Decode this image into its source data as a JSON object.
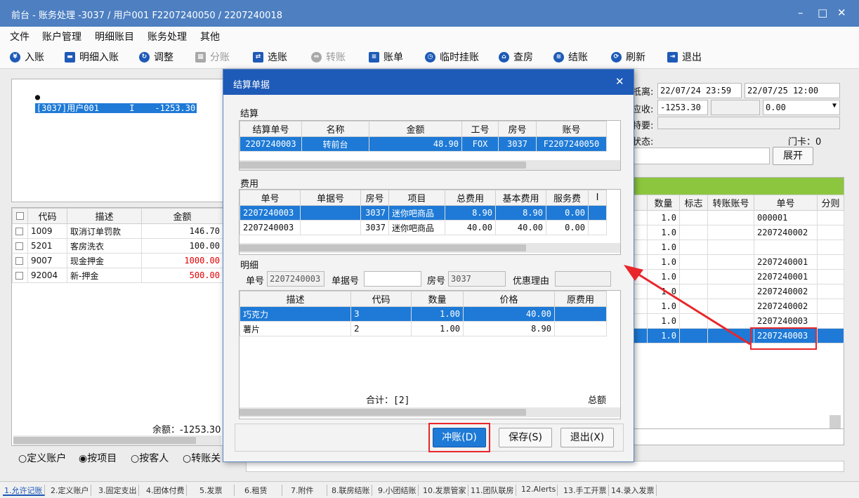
{
  "window": {
    "title": "前台 - 账务处理 -3037 / 用户001 F2207240050 / 2207240018",
    "minimize": "–",
    "maximize": "□",
    "close": "✕"
  },
  "menu": [
    "文件",
    "账户管理",
    "明细账目",
    "账务处理",
    "其他"
  ],
  "toolbar": [
    {
      "label": "入账",
      "icon": "yen-icon",
      "glyph": "¥",
      "disabled": false
    },
    {
      "label": "明细入账",
      "icon": "ledger-icon",
      "glyph": "▬",
      "disabled": false
    },
    {
      "label": "调整",
      "icon": "adjust-icon",
      "glyph": "↻",
      "disabled": false
    },
    {
      "label": "分账",
      "icon": "split-icon",
      "glyph": "▦",
      "disabled": true
    },
    {
      "label": "选账",
      "icon": "select-icon",
      "glyph": "⇄",
      "disabled": false
    },
    {
      "label": "转账",
      "icon": "transfer-icon",
      "glyph": "⇔",
      "disabled": true
    },
    {
      "label": "账单",
      "icon": "bill-icon",
      "glyph": "≡",
      "disabled": false
    },
    {
      "label": "临时挂账",
      "icon": "clock-icon",
      "glyph": "◷",
      "disabled": false
    },
    {
      "label": "查房",
      "icon": "house-icon",
      "glyph": "⌂",
      "disabled": false
    },
    {
      "label": "结账",
      "icon": "coins-icon",
      "glyph": "≋",
      "disabled": false
    },
    {
      "label": "刷新",
      "icon": "refresh-icon",
      "glyph": "⟳",
      "disabled": false
    },
    {
      "label": "退出",
      "icon": "exit-icon",
      "glyph": "⇥",
      "disabled": false
    }
  ],
  "account_tree": {
    "bullet": "●",
    "item": "[3037]用户001      I    -1253.30"
  },
  "left_grid": {
    "columns": [
      "代码",
      "描述",
      "金额"
    ],
    "rows": [
      {
        "code": "1009",
        "desc": "取消订单罚款",
        "amount": "146.70",
        "red": false
      },
      {
        "code": "5201",
        "desc": "客房洗衣",
        "amount": "100.00",
        "red": false
      },
      {
        "code": "9007",
        "desc": "现金押金",
        "amount": "1000.00",
        "red": true
      },
      {
        "code": "92004",
        "desc": "新-押金",
        "amount": "500.00",
        "red": true
      }
    ],
    "balance": "余额：-1253.30"
  },
  "radios": [
    {
      "label": "定义账户",
      "checked": false
    },
    {
      "label": "按项目",
      "checked": true
    },
    {
      "label": "按客人",
      "checked": false
    },
    {
      "label": "转账关",
      "checked": false
    }
  ],
  "right_info": {
    "depart_label": "抵离:",
    "depart_from": "22/07/24 23:59",
    "depart_to": "22/07/25 12:00",
    "due_label": "应收:",
    "due_value": "-1253.30",
    "due_select": "0.00",
    "special_label": "特要:",
    "status_label": "状态:",
    "doorcard": "门卡：0",
    "expand_button": "展开"
  },
  "right_grid": {
    "columns": [
      "数量",
      "标志",
      "转账账号",
      "单号",
      "分则"
    ],
    "rows": [
      {
        "qty": "1.0",
        "no": "000001"
      },
      {
        "qty": "1.0",
        "no": "2207240002"
      },
      {
        "qty": "1.0",
        "no": ""
      },
      {
        "qty": "1.0",
        "no": "2207240001"
      },
      {
        "qty": "1.0",
        "no": "2207240001"
      },
      {
        "qty": "1.0",
        "no": "2207240002"
      },
      {
        "qty": "1.0",
        "no": "2207240002"
      },
      {
        "qty": "1.0",
        "no": "2207240003"
      },
      {
        "qty": "1.0",
        "no": "2207240003",
        "selected": true
      }
    ]
  },
  "dialog": {
    "title": "结算单据",
    "close": "✕",
    "settle": {
      "label": "结算",
      "columns": [
        "结算单号",
        "名称",
        "金额",
        "工号",
        "房号",
        "账号"
      ],
      "row": [
        "2207240003",
        "转前台",
        "48.90",
        "FOX",
        "3037",
        "F2207240050"
      ]
    },
    "fees": {
      "label": "费用",
      "columns": [
        "单号",
        "单据号",
        "房号",
        "项目",
        "总费用",
        "基本费用",
        "服务费",
        "I"
      ],
      "rows": [
        {
          "cells": [
            "2207240003",
            "",
            "3037",
            "迷你吧商品",
            "8.90",
            "8.90",
            "0.00"
          ],
          "selected": true
        },
        {
          "cells": [
            "2207240003",
            "",
            "3037",
            "迷你吧商品",
            "40.00",
            "40.00",
            "0.00"
          ],
          "selected": false
        }
      ]
    },
    "detail": {
      "label": "明细",
      "no_label": "单号",
      "no_value": "2207240003",
      "voucher_label": "单据号",
      "voucher_value": "",
      "room_label": "房号",
      "room_value": "3037",
      "reason_label": "优惠理由",
      "reason_value": "",
      "columns": [
        "描述",
        "代码",
        "数量",
        "价格",
        "原费用"
      ],
      "rows": [
        {
          "cells": [
            "巧克力",
            "3",
            "1.00",
            "40.00",
            ""
          ],
          "selected": true
        },
        {
          "cells": [
            "薯片",
            "2",
            "1.00",
            "8.90",
            ""
          ],
          "selected": false
        }
      ],
      "total_count": "合计：[2]",
      "total_label": "总额"
    },
    "buttons": {
      "reverse": "冲账(D)",
      "save": "保存(S)",
      "exit": "退出(X)"
    }
  },
  "status_tabs": [
    "1.允许记账",
    "2.定义账户",
    "3.固定支出",
    "4.团体付费",
    "5.发票",
    "6.租赁",
    "7.附件",
    "8.联房结账",
    "9.小团结账",
    "10.发票管家",
    "11.团队联房",
    "12.Alerts",
    "13.手工开票",
    "14.录入发票"
  ],
  "accent": "#1e7ad6",
  "highlight": "#e8262a"
}
